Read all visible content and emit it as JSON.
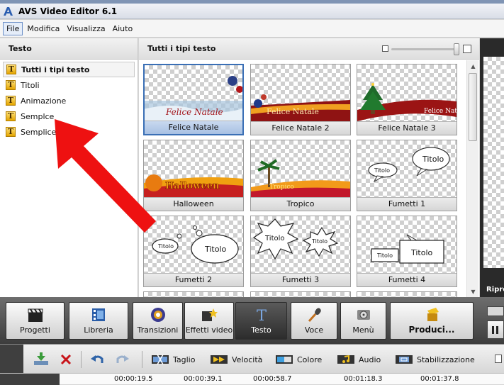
{
  "window": {
    "title": "AVS Video Editor 6.1"
  },
  "menu": [
    {
      "label": "File",
      "active": true
    },
    {
      "label": "Modifica"
    },
    {
      "label": "Visualizza"
    },
    {
      "label": "Aiuto"
    }
  ],
  "left_panel": {
    "title": "Testo",
    "items": [
      {
        "label": "Tutti i tipi testo",
        "selected": true
      },
      {
        "label": "Titoli"
      },
      {
        "label": "Animazione"
      },
      {
        "label": "Semplce"
      },
      {
        "label": "Semplice"
      }
    ]
  },
  "main_panel": {
    "title": "Tutti i tipi testo",
    "tiles": [
      {
        "caption": "Felice Natale",
        "preview_text": "Felice Natale"
      },
      {
        "caption": "Felice Natale 2",
        "preview_text": "Felice Natale"
      },
      {
        "caption": "Felice Natale 3",
        "preview_text": "Felice Natale"
      },
      {
        "caption": "Halloween",
        "preview_text": "Halloween"
      },
      {
        "caption": "Tropico",
        "preview_text": "Tropico"
      },
      {
        "caption": "Fumetti 1",
        "bubble_big": "Titolo",
        "bubble_small": "Titolo"
      },
      {
        "caption": "Fumetti 2",
        "bubble_big": "Titolo",
        "bubble_small": "Titolo"
      },
      {
        "caption": "Fumetti 3",
        "bubble_big": "Titolo",
        "bubble_small": "Titolo"
      },
      {
        "caption": "Fumetti 4",
        "bubble_big": "Titolo",
        "bubble_small": "Titolo"
      }
    ]
  },
  "preview": {
    "label": "Ripro"
  },
  "toolbar": {
    "buttons": [
      {
        "label": "Progetti"
      },
      {
        "label": "Libreria"
      },
      {
        "label": "Transizioni"
      },
      {
        "label": "Effetti video"
      },
      {
        "label": "Testo",
        "active": true
      },
      {
        "label": "Voce"
      },
      {
        "label": "Menù"
      },
      {
        "label": "Produci..."
      }
    ]
  },
  "edit_toolbar": {
    "taglio": "Taglio",
    "velocita": "Velocità",
    "colore": "Colore",
    "audio": "Audio",
    "stabilizzazione": "Stabilizzazione"
  },
  "timeline": {
    "ticks": [
      "00:00:19.5",
      "00:00:39.1",
      "00:00:58.7",
      "00:01:18.3",
      "00:01:37.8"
    ]
  },
  "colors": {
    "selection_border": "#3a6fb5",
    "annotation_arrow": "#ee1111",
    "toolbar_dark": "#3d3d3d"
  }
}
